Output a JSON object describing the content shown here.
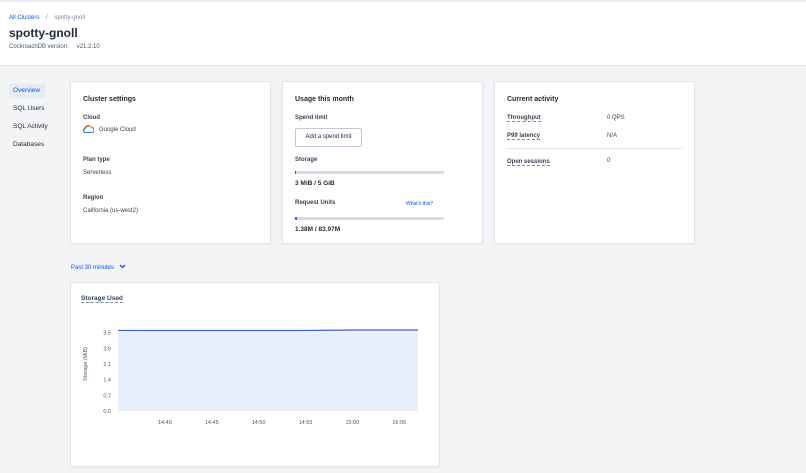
{
  "breadcrumb": {
    "root": "All Clusters",
    "separator": "/",
    "current": "spotty-gnoll"
  },
  "page": {
    "title": "spotty-gnoll",
    "version_label": "CockroachDB version:",
    "version": "v21.2.10"
  },
  "sidenav": {
    "items": [
      {
        "label": "Overview",
        "active": true
      },
      {
        "label": "SQL Users",
        "active": false
      },
      {
        "label": "SQL Activity",
        "active": false
      },
      {
        "label": "Databases",
        "active": false
      }
    ]
  },
  "cluster_settings": {
    "title": "Cluster settings",
    "cloud_label": "Cloud",
    "cloud_value": "Google Cloud",
    "plan_label": "Plan type",
    "plan_value": "Serverless",
    "region_label": "Region",
    "region_value": "California (us-west2)"
  },
  "usage": {
    "title": "Usage this month",
    "spend_label": "Spend limit",
    "spend_button": "Add a spend limit",
    "storage_label": "Storage",
    "storage_value": "3 MiB / 5 GiB",
    "storage_fraction": 0.0006,
    "ru_label": "Request Units",
    "ru_help": "What's this?",
    "ru_value": "1.38M / 83.97M",
    "ru_fraction": 0.016
  },
  "activity": {
    "title": "Current activity",
    "throughput_label": "Throughput",
    "throughput_value": "0 QPS",
    "p99_label": "P99 latency",
    "p99_value": "N/A",
    "sessions_label": "Open sessions",
    "sessions_value": "0"
  },
  "time_range": {
    "label": "Past 30 minutes"
  },
  "colors": {
    "accent": "#0055ff",
    "area_fill": "#e8f0fd",
    "line": "#3a5ccc"
  },
  "chart_data": {
    "type": "area",
    "title": "Storage Used",
    "xlabel": "",
    "ylabel": "Storage (MiB)",
    "x_ticks": [
      "14:40",
      "14:45",
      "14:50",
      "14:55",
      "15:00",
      "15:05"
    ],
    "y_ticks": [
      "0.0",
      "0.7",
      "1.4",
      "2.1",
      "2.8",
      "3.5"
    ],
    "ylim": [
      0,
      4.2
    ],
    "x": [
      "14:35",
      "14:40",
      "14:45",
      "14:50",
      "14:55",
      "15:00",
      "15:05",
      "15:07"
    ],
    "series": [
      {
        "values": [
          3.6,
          3.6,
          3.6,
          3.6,
          3.6,
          3.62,
          3.62,
          3.62
        ]
      }
    ],
    "grid": false
  }
}
